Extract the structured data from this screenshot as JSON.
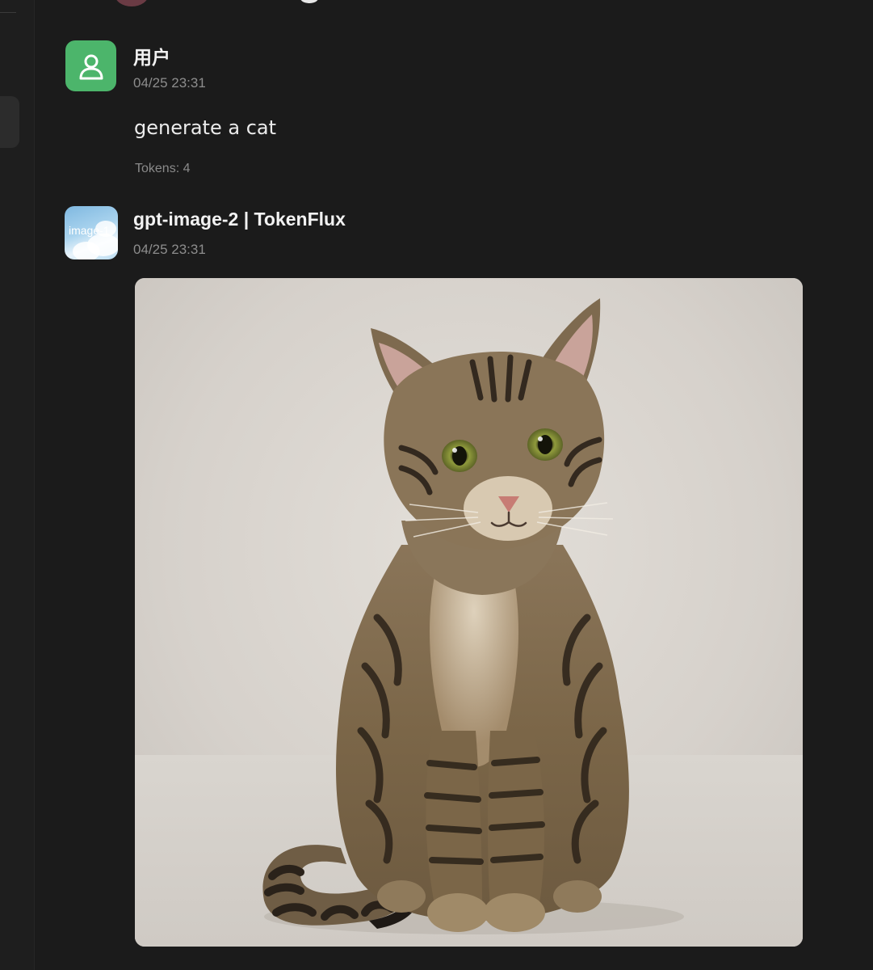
{
  "messages": [
    {
      "sender": "用户",
      "time": "04/25 23:31",
      "text": "generate a cat",
      "tokens": "Tokens: 4",
      "avatar_icon": "user-icon",
      "avatar_color": "#4cb56b"
    },
    {
      "sender": "gpt-image-2 | TokenFlux",
      "time": "04/25 23:31",
      "avatar_label": "image-1",
      "image_subject": "tabby-cat"
    }
  ],
  "colors": {
    "background": "#1b1b1b",
    "user_avatar": "#4cb56b",
    "text_primary": "#f2f2f2",
    "text_muted": "#8d8d8d"
  }
}
